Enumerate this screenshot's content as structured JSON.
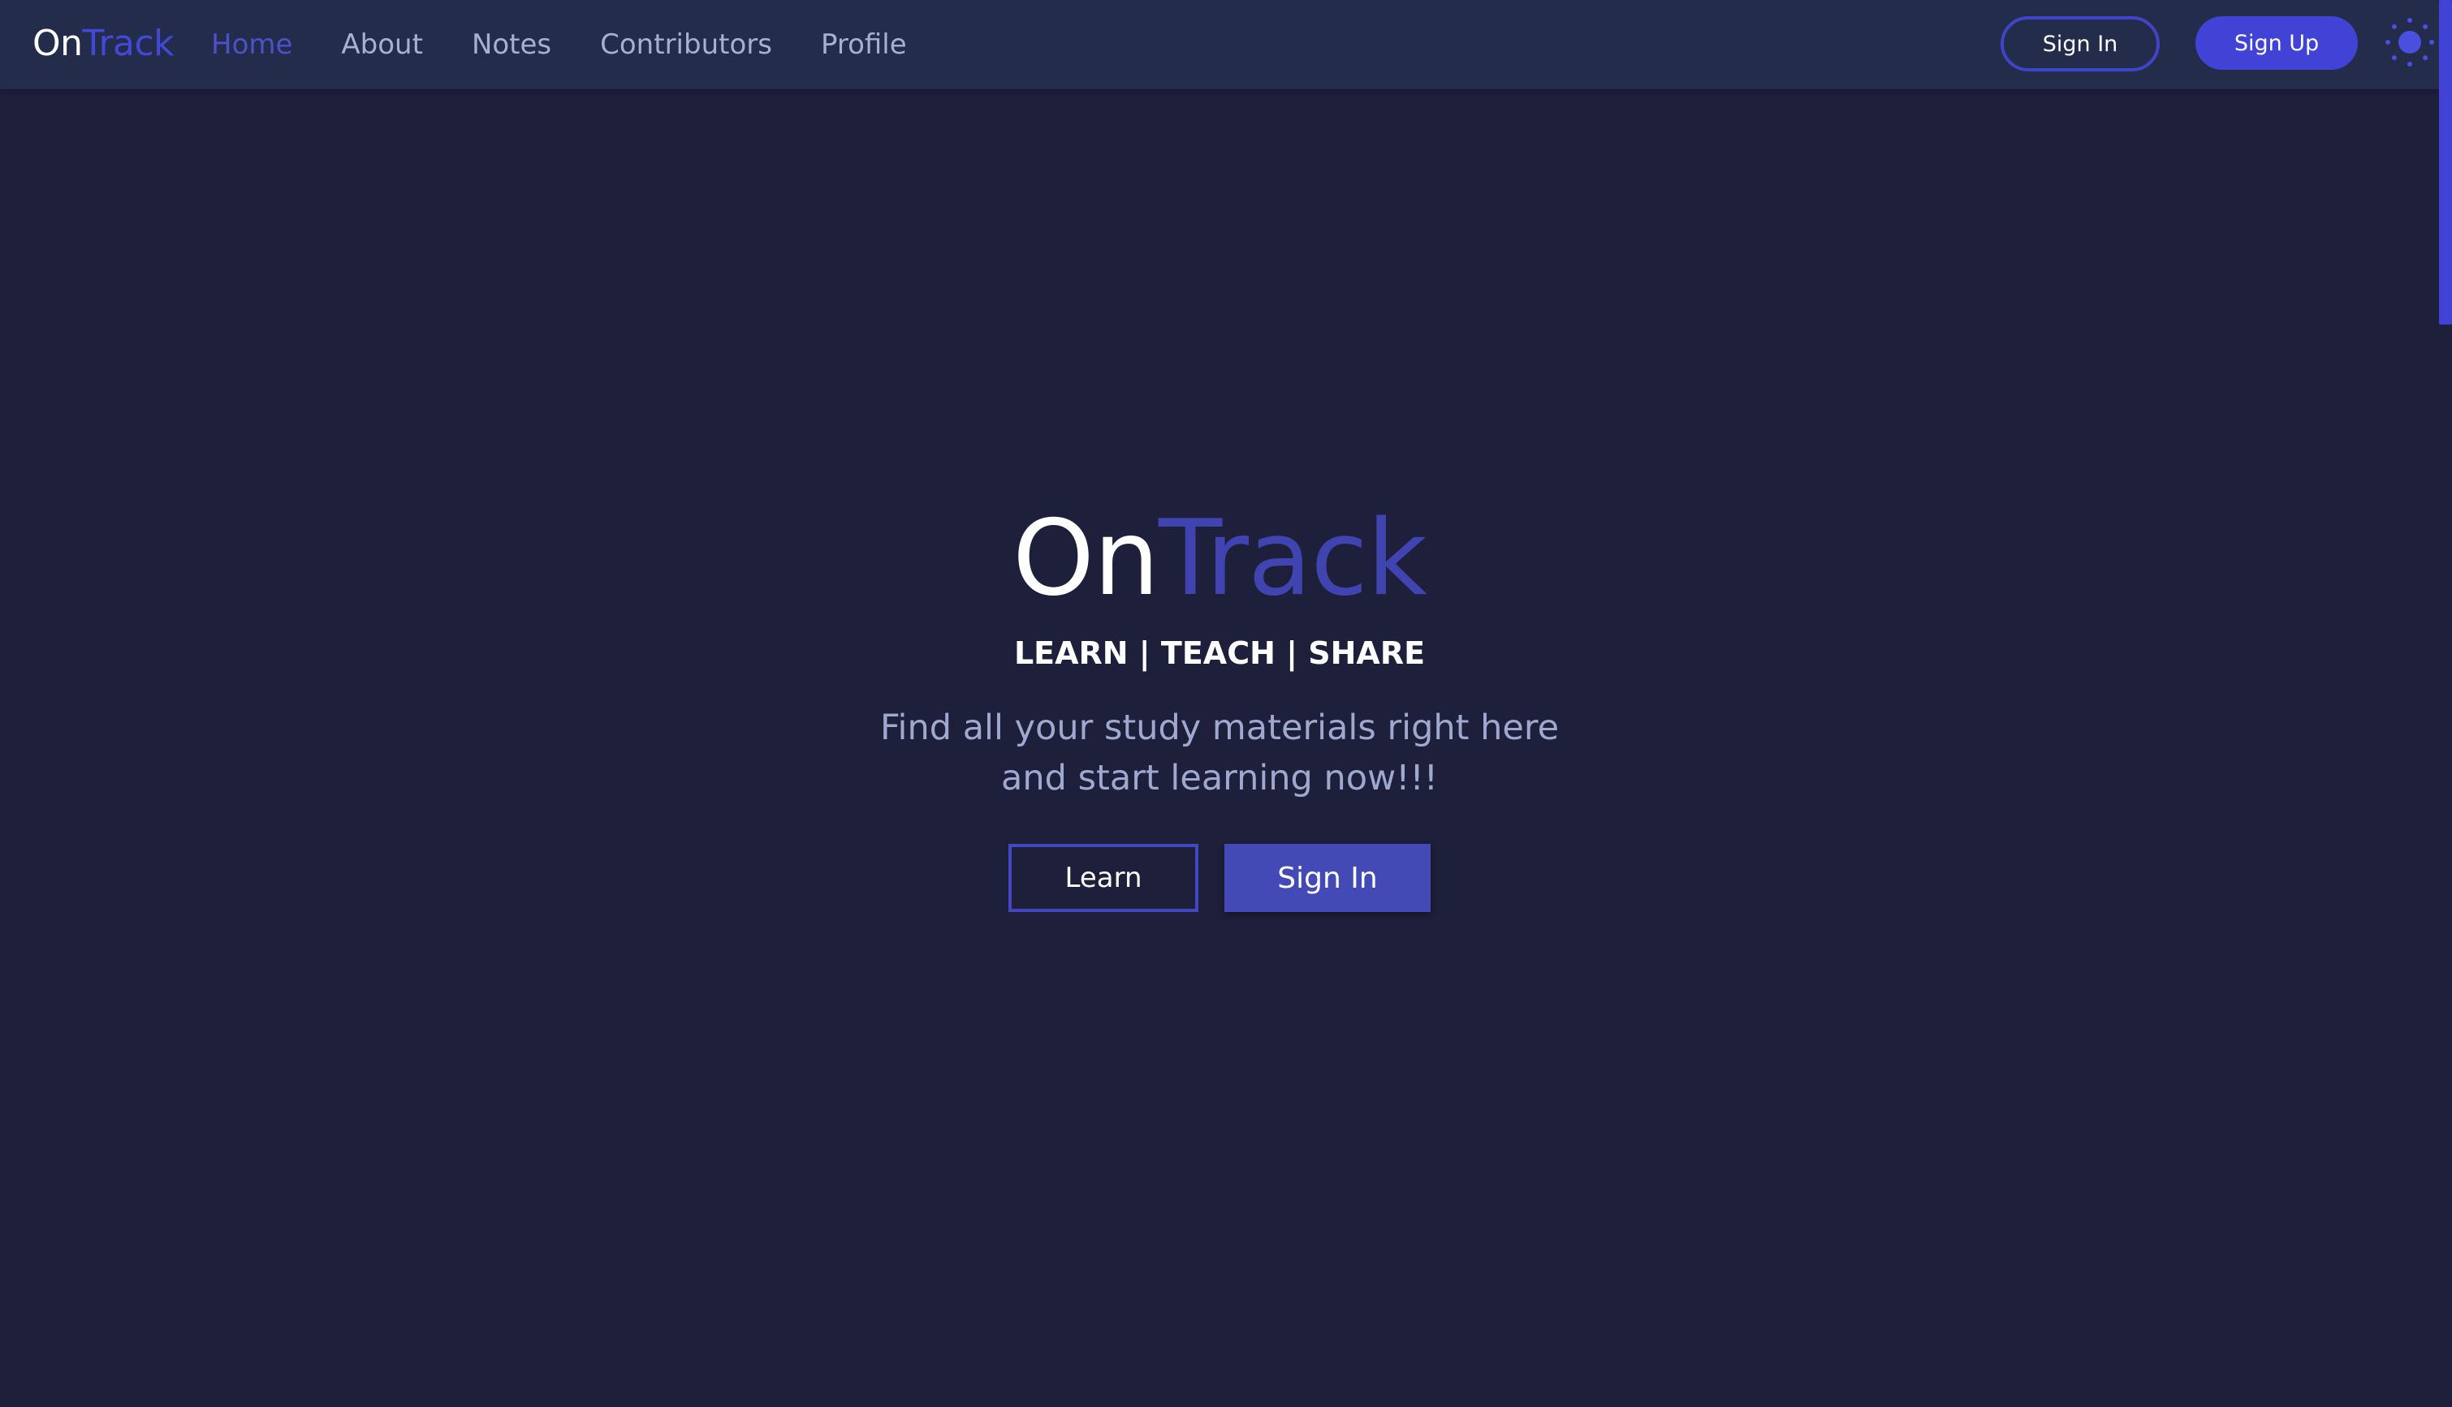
{
  "navbar": {
    "brand": {
      "part1": "On",
      "part2": "Track"
    },
    "links": [
      {
        "label": "Home",
        "active": true
      },
      {
        "label": "About",
        "active": false
      },
      {
        "label": "Notes",
        "active": false
      },
      {
        "label": "Contributors",
        "active": false
      },
      {
        "label": "Profile",
        "active": false
      }
    ],
    "signin_label": "Sign In",
    "signup_label": "Sign Up",
    "theme_toggle_icon": "sun-icon"
  },
  "hero": {
    "title": {
      "part1": "On",
      "part2": "Track"
    },
    "tagline": "LEARN | TEACH | SHARE",
    "description_line1": "Find all your study materials right here",
    "description_line2": "and start learning now!!!",
    "learn_label": "Learn",
    "signin_label": "Sign In"
  },
  "colors": {
    "background": "#1e1f3b",
    "navbar": "#232d4b",
    "accent": "#4143d6",
    "title_accent": "#3f44b0",
    "muted_text": "#a7b0cf"
  }
}
